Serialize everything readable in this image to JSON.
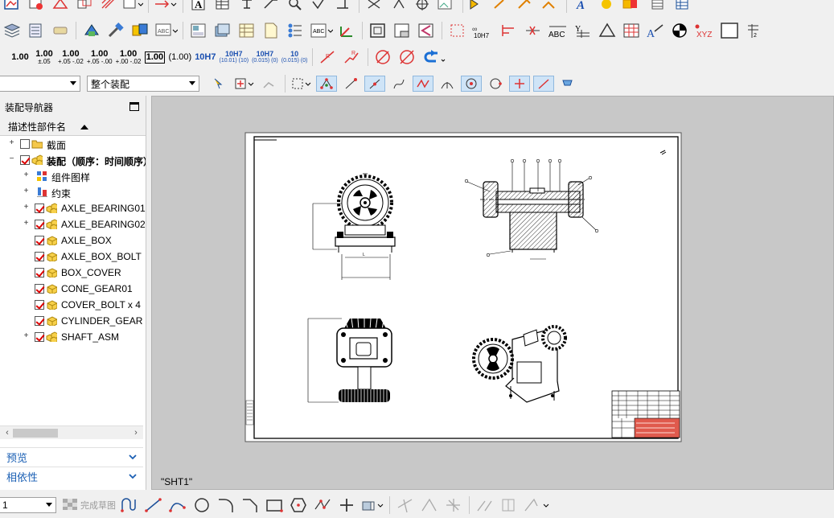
{
  "toolbar": {
    "tolerances": [
      {
        "main": "1.00",
        "sub": ""
      },
      {
        "main": "1.00",
        "sub": "±.05"
      },
      {
        "main": "1.00",
        "sub": "+.05 -.02"
      },
      {
        "main": "1.00",
        "sub": "+.05 -.00"
      },
      {
        "main": "1.00",
        "sub": "+.00 -.02"
      },
      {
        "main": "1.00",
        "sub": "boxed"
      },
      {
        "main": "(1.00)",
        "sub": ""
      },
      {
        "main": "10H7",
        "sub": ""
      },
      {
        "main": "10H7",
        "sub": "(10.01) (10)"
      },
      {
        "main": "10H7",
        "sub": "(0.015) (0)"
      },
      {
        "main": "10",
        "sub": "(0.015) (0)"
      }
    ],
    "fit_label": "10H7",
    "abc_label": "ABC",
    "xyz_label": "XYZ",
    "filter_select": "",
    "scope_select": "整个装配"
  },
  "navigator": {
    "title": "装配导航器",
    "column_header": "描述性部件名",
    "tree": [
      {
        "label": "截面",
        "level": 0,
        "expander": "+",
        "checked": false,
        "icon": "folder-icon",
        "bold": false
      },
      {
        "label": "装配（顺序：时间顺序）",
        "level": 0,
        "expander": "−",
        "checked": true,
        "icon": "assembly-icon",
        "bold": true
      },
      {
        "label": "组件图样",
        "level": 1,
        "expander": "+",
        "checked": null,
        "icon": "pattern-icon",
        "bold": false
      },
      {
        "label": "约束",
        "level": 1,
        "expander": "+",
        "checked": null,
        "icon": "constraint-icon",
        "bold": false
      },
      {
        "label": "AXLE_BEARING01",
        "level": 1,
        "expander": "+",
        "checked": true,
        "icon": "subassembly-icon",
        "bold": false
      },
      {
        "label": "AXLE_BEARING02",
        "level": 1,
        "expander": "+",
        "checked": true,
        "icon": "subassembly-icon",
        "bold": false
      },
      {
        "label": "AXLE_BOX",
        "level": 1,
        "expander": "",
        "checked": true,
        "icon": "part-icon",
        "bold": false
      },
      {
        "label": "AXLE_BOX_BOLT",
        "level": 1,
        "expander": "",
        "checked": true,
        "icon": "part-icon",
        "bold": false
      },
      {
        "label": "BOX_COVER",
        "level": 1,
        "expander": "",
        "checked": true,
        "icon": "part-icon",
        "bold": false
      },
      {
        "label": "CONE_GEAR01",
        "level": 1,
        "expander": "",
        "checked": true,
        "icon": "part-icon",
        "bold": false
      },
      {
        "label": "COVER_BOLT x 4",
        "level": 1,
        "expander": "",
        "checked": true,
        "icon": "part-icon",
        "bold": false
      },
      {
        "label": "CYLINDER_GEAR",
        "level": 1,
        "expander": "",
        "checked": true,
        "icon": "part-icon",
        "bold": false
      },
      {
        "label": "SHAFT_ASM",
        "level": 1,
        "expander": "+",
        "checked": true,
        "icon": "subassembly-icon",
        "bold": false
      }
    ],
    "panels": [
      "预览",
      "相依性"
    ]
  },
  "drawing": {
    "sheet_name": "\"SHT1\""
  },
  "bottom": {
    "layer_select": "1",
    "finish_sketch": "完成草图"
  }
}
